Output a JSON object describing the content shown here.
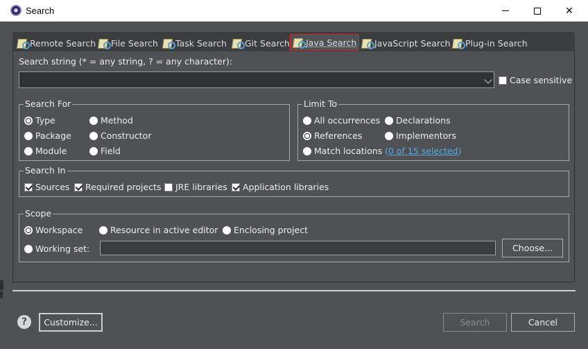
{
  "window": {
    "title": "Search"
  },
  "tabs": [
    {
      "label": "Remote Search"
    },
    {
      "label": "File Search"
    },
    {
      "label": "Task Search"
    },
    {
      "label": "Git Search"
    },
    {
      "label": "Java Search",
      "active": true
    },
    {
      "label": "JavaScript Search"
    },
    {
      "label": "Plug-in Search"
    }
  ],
  "search_string": {
    "label": "Search string (* = any string, ? = any character):",
    "value": "",
    "case_sensitive_label": "Case sensitive",
    "case_sensitive": false
  },
  "search_for": {
    "title": "Search For",
    "options": [
      "Type",
      "Method",
      "Package",
      "Constructor",
      "Module",
      "Field"
    ],
    "selected": "Type"
  },
  "limit_to": {
    "title": "Limit To",
    "options": [
      "All occurrences",
      "Declarations",
      "References",
      "Implementors",
      "Match locations"
    ],
    "selected": "References",
    "match_locations_link": "0 of 15 selected",
    "paren_open": "(",
    "paren_close": ")"
  },
  "search_in": {
    "title": "Search In",
    "sources": "Sources",
    "required_projects": "Required projects",
    "jre_libraries": "JRE libraries",
    "application_libraries": "Application libraries"
  },
  "scope": {
    "title": "Scope",
    "workspace": "Workspace",
    "resource": "Resource in active editor",
    "enclosing": "Enclosing project",
    "working_set": "Working set:",
    "working_set_value": "",
    "choose": "Choose..."
  },
  "footer": {
    "help_glyph": "?",
    "customize": "Customize...",
    "search": "Search",
    "cancel": "Cancel"
  },
  "colors": {
    "background": "#4f5254",
    "tab_bar": "#3b3d3f",
    "active_tab_border": "#dd2222",
    "link": "#5aa9e6"
  }
}
